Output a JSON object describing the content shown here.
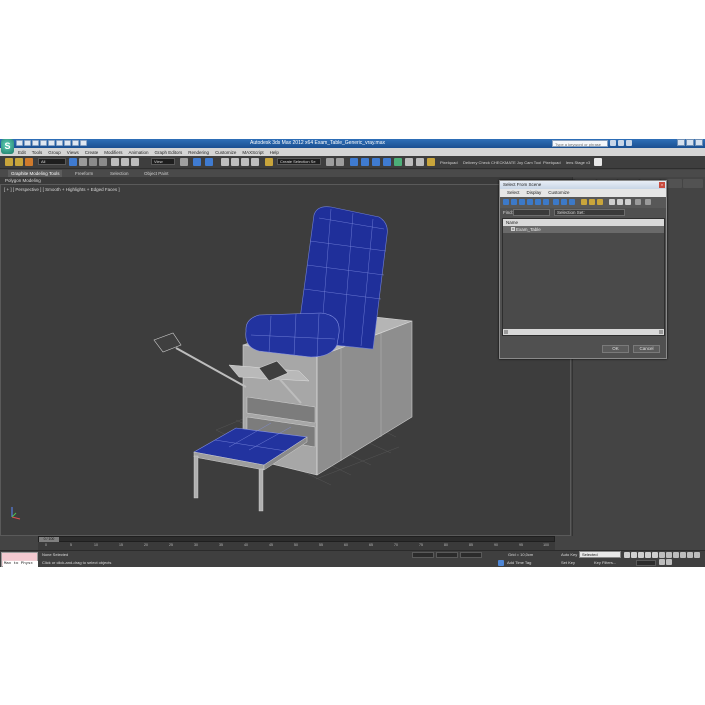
{
  "window": {
    "title": "Autodesk 3ds Max  2012 x64      Exam_Table_Generic_vray.max",
    "search_placeholder": "Type a keyword or phrase"
  },
  "menu": [
    "Edit",
    "Tools",
    "Group",
    "Views",
    "Create",
    "Modifiers",
    "Animation",
    "Graph Editors",
    "Rendering",
    "Customize",
    "MAXScript",
    "Help"
  ],
  "toolbar": {
    "filter_value": "All",
    "view_value": "View",
    "named_selection": "Create Selection Se",
    "pixelquad_label": "Pixelquad",
    "tools_text": "Delivery Check  CHECKMATE  Joy Cam Tool",
    "pixelquad2_label": "Pixelquad",
    "lens_text": "lens Stage v3"
  },
  "ribbon": {
    "tabs": [
      "Graphite Modeling Tools",
      "Freeform",
      "Selection",
      "Object Paint"
    ],
    "sub_label": "Polygon Modeling"
  },
  "viewport": {
    "label": "[ + ] [ Perspective ] [ Smooth + Highlights + Edged Faces ]",
    "axis_labels": {
      "x": "x",
      "y": "y",
      "z": "z"
    }
  },
  "dialog": {
    "title": "Select From Scene",
    "close_glyph": "×",
    "menu": [
      "Select",
      "Display",
      "Customize"
    ],
    "find_label": "Find:",
    "selection_set_label": "Selection Set:",
    "list_header": "Name",
    "list_items": [
      "Exam_Table"
    ],
    "ok_label": "OK",
    "cancel_label": "Cancel"
  },
  "timeline": {
    "thumb_label": "0 / 100",
    "ticks": [
      "0",
      "5",
      "10",
      "15",
      "20",
      "25",
      "30",
      "35",
      "40",
      "45",
      "50",
      "55",
      "60",
      "65",
      "70",
      "75",
      "80",
      "85",
      "90",
      "95",
      "100"
    ]
  },
  "status": {
    "maxscript_text": "Max to Physx",
    "selected_text": "None Selected",
    "prompt_text": "Click or click-and-drag to select objects",
    "grid_text": "Grid = 10,0cm",
    "add_time_tag": "Add Time Tag",
    "auto_key_label": "Auto Key",
    "auto_key_value": "Selected",
    "set_key_label": "Set Key",
    "key_filters_label": "Key Filters..."
  },
  "colors": {
    "upholstery": "#1f2f9a",
    "frame": "#9d9d9d",
    "viewport_bg": "#3d3d3d",
    "title_bar": "#1a4f91"
  }
}
